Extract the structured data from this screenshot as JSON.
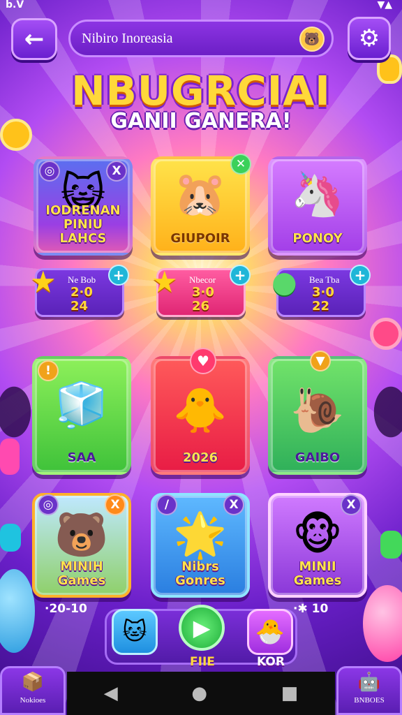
{
  "status_bar": {
    "left": "b.V",
    "right": "▼▲"
  },
  "search": {
    "value": "Nibiro Inoreasia"
  },
  "header": {
    "title": "NBUGRCIAI",
    "subtitle": "GANII GANERA!"
  },
  "colors": {
    "accent": "#8c34e3",
    "title_yellow": "#ffd83a"
  },
  "featured_cards": [
    {
      "label": "IODRENAN PINIU LAHCS",
      "icon": "green-cat-icon",
      "badge_left": "◎",
      "badge_right": "X"
    },
    {
      "label": "GIUPOIR",
      "icon": "hamster-icon",
      "badge_left": "",
      "badge_right": "✕"
    },
    {
      "label": "PONOY",
      "icon": "hat-pony-icon",
      "badge_left": "",
      "badge_right": ""
    }
  ],
  "stat_boxes": [
    {
      "head": "Ne Bob",
      "line1": "2·0",
      "line2": "24",
      "plus": "+"
    },
    {
      "head": "Nbecor",
      "line1": "3·0",
      "line2": "26",
      "plus": "+"
    },
    {
      "head": "Bea Tba",
      "line1": "3·0",
      "line2": "22",
      "plus": "+"
    }
  ],
  "mid_cards": [
    {
      "label": "SAA",
      "icon": "blocks-icon",
      "badge": "!"
    },
    {
      "label": "2026",
      "icon": "chick-icon",
      "badge": "♥"
    },
    {
      "label": "GAIBO",
      "icon": "snail-icon",
      "badge": "▼"
    }
  ],
  "game_cards": [
    {
      "label": "MINIH Games",
      "icon": "pink-bear-icon",
      "badge_left": "◎",
      "badge_right": "X"
    },
    {
      "label": "Nibrs Gonres",
      "icon": "sun-creature-icon",
      "badge_left": "/",
      "badge_right": "X"
    },
    {
      "label": "MINII Games",
      "icon": "bear-hat-icon",
      "badge_left": "",
      "badge_right": "X"
    }
  ],
  "bottom_bar": {
    "left_stat": "·20-10",
    "right_stat": "·✱ 10",
    "play_label": "FIIE",
    "right_label": "KOR"
  },
  "corner_buttons": {
    "left": "Nokioes",
    "right": "BNBOES"
  },
  "system_nav": {
    "back": "◀",
    "home": "●",
    "recents": "■"
  }
}
